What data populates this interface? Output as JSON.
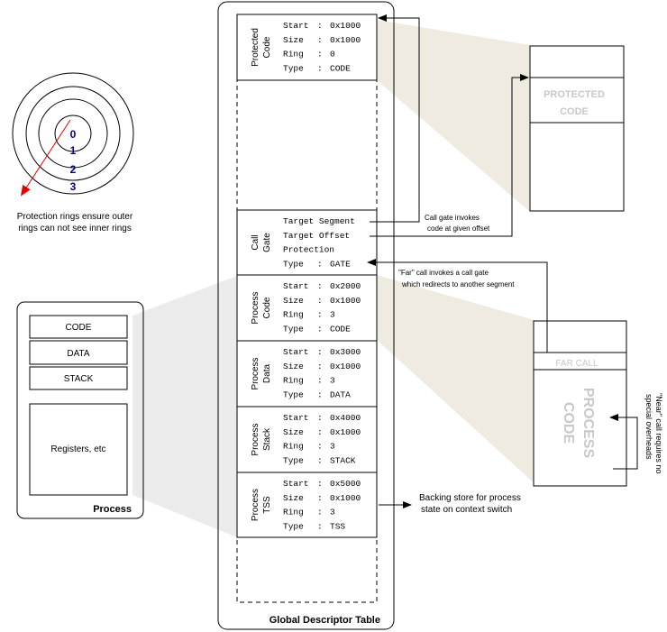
{
  "colors": {
    "shade_tan": "#EFEBE0",
    "shade_grey": "#EBEBEB",
    "ring_number": "#00007F",
    "pointer_arrow": "#E00000",
    "faded_text": "#C8C8C8"
  },
  "rings": {
    "labels": [
      "0",
      "1",
      "2",
      "3"
    ],
    "caption_line1": "Protection rings ensure outer",
    "caption_line2": "rings can not see inner rings"
  },
  "process": {
    "title": "Process",
    "segments": [
      "CODE",
      "DATA",
      "STACK"
    ],
    "registers_label": "Registers, etc"
  },
  "gdt": {
    "title": "Global Descriptor Table",
    "entries": [
      {
        "name_line1": "Protected",
        "name_line2": "Code",
        "fields": [
          {
            "key": "Start",
            "value": "0x1000"
          },
          {
            "key": "Size",
            "value": "0x1000"
          },
          {
            "key": "Ring",
            "value": "0"
          },
          {
            "key": "Type",
            "value": "CODE"
          }
        ]
      },
      {
        "name_line1": "Call",
        "name_line2": "Gate",
        "fields": [
          {
            "key": "Target Segment",
            "value": ""
          },
          {
            "key": "Target Offset",
            "value": ""
          },
          {
            "key": "Protection",
            "value": ""
          },
          {
            "key": "Type",
            "value": "GATE"
          }
        ]
      },
      {
        "name_line1": "Process",
        "name_line2": "Code",
        "fields": [
          {
            "key": "Start",
            "value": "0x2000"
          },
          {
            "key": "Size",
            "value": "0x1000"
          },
          {
            "key": "Ring",
            "value": "3"
          },
          {
            "key": "Type",
            "value": "CODE"
          }
        ]
      },
      {
        "name_line1": "Process",
        "name_line2": "Data",
        "fields": [
          {
            "key": "Start",
            "value": "0x3000"
          },
          {
            "key": "Size",
            "value": "0x1000"
          },
          {
            "key": "Ring",
            "value": "3"
          },
          {
            "key": "Type",
            "value": "DATA"
          }
        ]
      },
      {
        "name_line1": "Process",
        "name_line2": "Stack",
        "fields": [
          {
            "key": "Start",
            "value": "0x4000"
          },
          {
            "key": "Size",
            "value": "0x1000"
          },
          {
            "key": "Ring",
            "value": "3"
          },
          {
            "key": "Type",
            "value": "STACK"
          }
        ]
      },
      {
        "name_line1": "Process",
        "name_line2": "TSS",
        "fields": [
          {
            "key": "Start",
            "value": "0x5000"
          },
          {
            "key": "Size",
            "value": "0x1000"
          },
          {
            "key": "Ring",
            "value": "3"
          },
          {
            "key": "Type",
            "value": "TSS"
          }
        ]
      }
    ]
  },
  "protected_memory": {
    "label_line1": "PROTECTED",
    "label_line2": "CODE"
  },
  "process_memory": {
    "far_call_label": "FAR CALL",
    "label_line1": "PROCESS",
    "label_line2": "CODE"
  },
  "annotations": {
    "call_gate_line1": "Call gate invokes",
    "call_gate_line2": "code at given offset",
    "far_call_line1": "\"Far\" call invokes a call gate",
    "far_call_line2": "which redirects to another segment",
    "backing_line1": "Backing store for process",
    "backing_line2": "state on context switch",
    "near_call_line1": "\"Near\" call requires no",
    "near_call_line2": "special overheads"
  }
}
